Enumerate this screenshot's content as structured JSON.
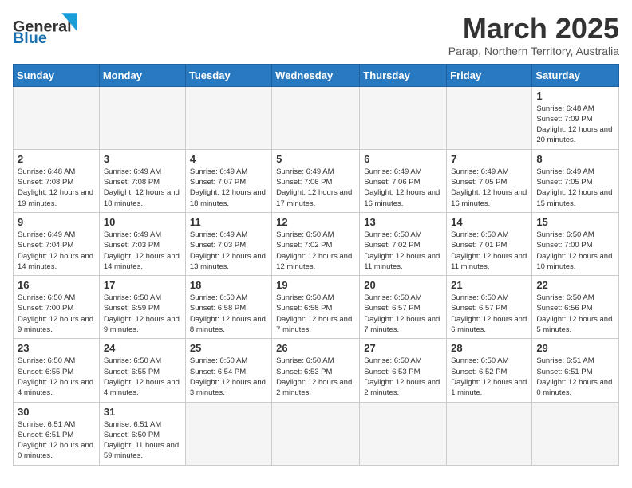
{
  "logo": {
    "text_general": "General",
    "text_blue": "Blue"
  },
  "header": {
    "month_year": "March 2025",
    "location": "Parap, Northern Territory, Australia"
  },
  "weekdays": [
    "Sunday",
    "Monday",
    "Tuesday",
    "Wednesday",
    "Thursday",
    "Friday",
    "Saturday"
  ],
  "days": [
    {
      "num": "",
      "info": ""
    },
    {
      "num": "",
      "info": ""
    },
    {
      "num": "",
      "info": ""
    },
    {
      "num": "",
      "info": ""
    },
    {
      "num": "",
      "info": ""
    },
    {
      "num": "",
      "info": ""
    },
    {
      "num": "1",
      "info": "Sunrise: 6:48 AM\nSunset: 7:09 PM\nDaylight: 12 hours and 20 minutes."
    },
    {
      "num": "2",
      "info": "Sunrise: 6:48 AM\nSunset: 7:08 PM\nDaylight: 12 hours and 19 minutes."
    },
    {
      "num": "3",
      "info": "Sunrise: 6:49 AM\nSunset: 7:08 PM\nDaylight: 12 hours and 18 minutes."
    },
    {
      "num": "4",
      "info": "Sunrise: 6:49 AM\nSunset: 7:07 PM\nDaylight: 12 hours and 18 minutes."
    },
    {
      "num": "5",
      "info": "Sunrise: 6:49 AM\nSunset: 7:06 PM\nDaylight: 12 hours and 17 minutes."
    },
    {
      "num": "6",
      "info": "Sunrise: 6:49 AM\nSunset: 7:06 PM\nDaylight: 12 hours and 16 minutes."
    },
    {
      "num": "7",
      "info": "Sunrise: 6:49 AM\nSunset: 7:05 PM\nDaylight: 12 hours and 16 minutes."
    },
    {
      "num": "8",
      "info": "Sunrise: 6:49 AM\nSunset: 7:05 PM\nDaylight: 12 hours and 15 minutes."
    },
    {
      "num": "9",
      "info": "Sunrise: 6:49 AM\nSunset: 7:04 PM\nDaylight: 12 hours and 14 minutes."
    },
    {
      "num": "10",
      "info": "Sunrise: 6:49 AM\nSunset: 7:03 PM\nDaylight: 12 hours and 14 minutes."
    },
    {
      "num": "11",
      "info": "Sunrise: 6:49 AM\nSunset: 7:03 PM\nDaylight: 12 hours and 13 minutes."
    },
    {
      "num": "12",
      "info": "Sunrise: 6:50 AM\nSunset: 7:02 PM\nDaylight: 12 hours and 12 minutes."
    },
    {
      "num": "13",
      "info": "Sunrise: 6:50 AM\nSunset: 7:02 PM\nDaylight: 12 hours and 11 minutes."
    },
    {
      "num": "14",
      "info": "Sunrise: 6:50 AM\nSunset: 7:01 PM\nDaylight: 12 hours and 11 minutes."
    },
    {
      "num": "15",
      "info": "Sunrise: 6:50 AM\nSunset: 7:00 PM\nDaylight: 12 hours and 10 minutes."
    },
    {
      "num": "16",
      "info": "Sunrise: 6:50 AM\nSunset: 7:00 PM\nDaylight: 12 hours and 9 minutes."
    },
    {
      "num": "17",
      "info": "Sunrise: 6:50 AM\nSunset: 6:59 PM\nDaylight: 12 hours and 9 minutes."
    },
    {
      "num": "18",
      "info": "Sunrise: 6:50 AM\nSunset: 6:58 PM\nDaylight: 12 hours and 8 minutes."
    },
    {
      "num": "19",
      "info": "Sunrise: 6:50 AM\nSunset: 6:58 PM\nDaylight: 12 hours and 7 minutes."
    },
    {
      "num": "20",
      "info": "Sunrise: 6:50 AM\nSunset: 6:57 PM\nDaylight: 12 hours and 7 minutes."
    },
    {
      "num": "21",
      "info": "Sunrise: 6:50 AM\nSunset: 6:57 PM\nDaylight: 12 hours and 6 minutes."
    },
    {
      "num": "22",
      "info": "Sunrise: 6:50 AM\nSunset: 6:56 PM\nDaylight: 12 hours and 5 minutes."
    },
    {
      "num": "23",
      "info": "Sunrise: 6:50 AM\nSunset: 6:55 PM\nDaylight: 12 hours and 4 minutes."
    },
    {
      "num": "24",
      "info": "Sunrise: 6:50 AM\nSunset: 6:55 PM\nDaylight: 12 hours and 4 minutes."
    },
    {
      "num": "25",
      "info": "Sunrise: 6:50 AM\nSunset: 6:54 PM\nDaylight: 12 hours and 3 minutes."
    },
    {
      "num": "26",
      "info": "Sunrise: 6:50 AM\nSunset: 6:53 PM\nDaylight: 12 hours and 2 minutes."
    },
    {
      "num": "27",
      "info": "Sunrise: 6:50 AM\nSunset: 6:53 PM\nDaylight: 12 hours and 2 minutes."
    },
    {
      "num": "28",
      "info": "Sunrise: 6:50 AM\nSunset: 6:52 PM\nDaylight: 12 hours and 1 minute."
    },
    {
      "num": "29",
      "info": "Sunrise: 6:51 AM\nSunset: 6:51 PM\nDaylight: 12 hours and 0 minutes."
    },
    {
      "num": "30",
      "info": "Sunrise: 6:51 AM\nSunset: 6:51 PM\nDaylight: 12 hours and 0 minutes."
    },
    {
      "num": "31",
      "info": "Sunrise: 6:51 AM\nSunset: 6:50 PM\nDaylight: 11 hours and 59 minutes."
    },
    {
      "num": "",
      "info": ""
    },
    {
      "num": "",
      "info": ""
    },
    {
      "num": "",
      "info": ""
    },
    {
      "num": "",
      "info": ""
    },
    {
      "num": "",
      "info": ""
    }
  ]
}
